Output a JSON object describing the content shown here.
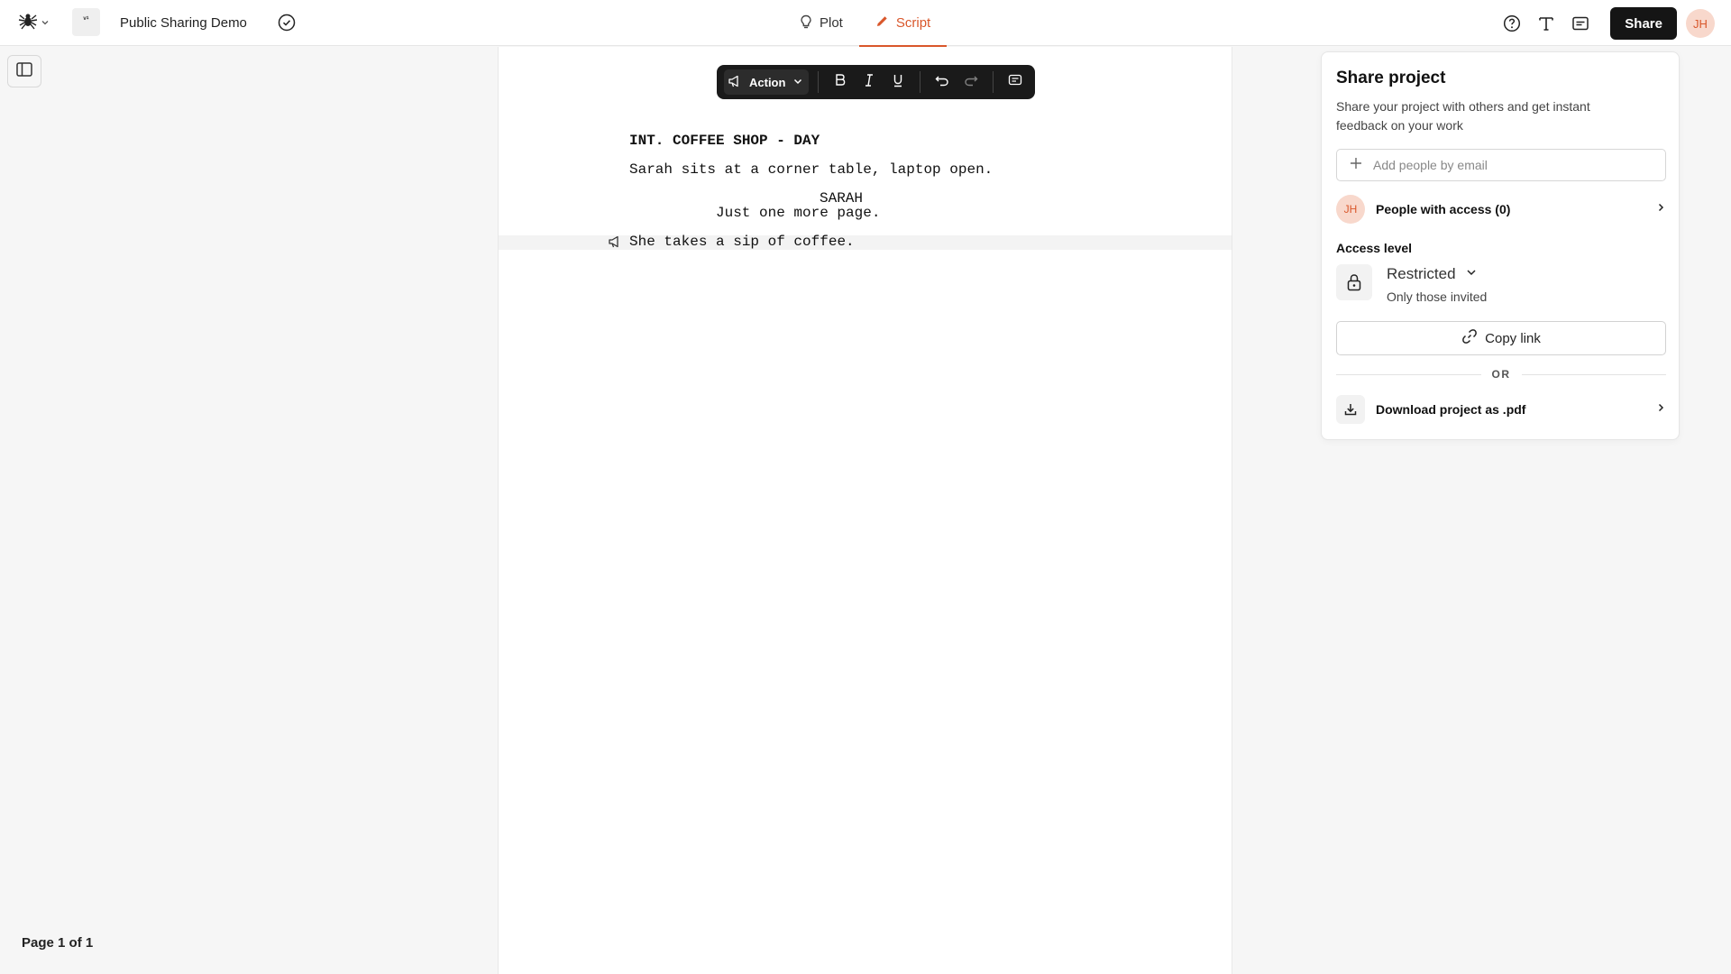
{
  "header": {
    "logo_icon": "spider-logo-icon",
    "doc_badge": "ᵛ¹",
    "project_title": "Public Sharing Demo",
    "tabs": [
      {
        "label": "Plot",
        "icon": "lightbulb-icon",
        "active": false
      },
      {
        "label": "Script",
        "icon": "pencil-icon",
        "active": true
      }
    ],
    "share_label": "Share",
    "avatar_initials": "JH",
    "accent_color": "#d9572b"
  },
  "sidebar": {
    "page_indicator": "Page 1 of 1"
  },
  "toolbar": {
    "element_type": "Action"
  },
  "script": {
    "scene_heading": "INT. COFFEE SHOP - DAY",
    "action_1": "Sarah sits at a corner table, laptop open.",
    "character": "SARAH",
    "dialogue": "Just one more page.",
    "action_2": "She takes a sip of coffee."
  },
  "share_panel": {
    "title": "Share project",
    "description": "Share your project with others and get instant feedback on your work",
    "email_placeholder": "Add people by email",
    "people_avatar": "JH",
    "people_label": "People with access (0)",
    "access_label": "Access level",
    "access_value": "Restricted",
    "access_sub": "Only those invited",
    "copy_link_label": "Copy link",
    "or_label": "OR",
    "download_label": "Download project as .pdf"
  }
}
